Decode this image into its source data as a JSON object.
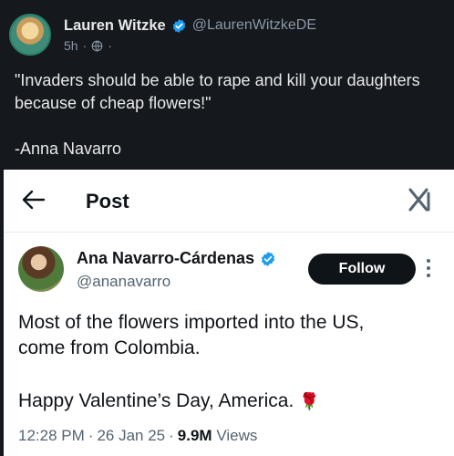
{
  "outer_post": {
    "author_name": "Lauren Witzke",
    "handle": "@LaurenWitzkeDE",
    "timestamp": "5h",
    "meta_dot": "·",
    "text": "\"Invaders should be able to rape and kill your daughters because of cheap flowers!\"",
    "attribution": "-Anna Navarro",
    "icons": {
      "verified": "verified-badge-icon",
      "audience": "globe-icon"
    },
    "colors": {
      "background": "#15181c",
      "verified": "#1d9bf0"
    }
  },
  "embedded_screenshot": {
    "header": {
      "title": "Post",
      "back_icon": "back-arrow-icon",
      "logo_icon": "x-logo-icon"
    },
    "author": {
      "name": "Ana Navarro-Cárdenas",
      "handle": "@ananavarro",
      "follow_label": "Follow",
      "more_icon": "more-vertical-icon"
    },
    "body_line_1": "Most of the flowers imported into the US,",
    "body_line_2": "come from Colombia.",
    "body_line_3": "Happy Valentine’s Day, America.",
    "emoji": "🌹",
    "meta": {
      "time": "12:28 PM",
      "date": "26 Jan 25",
      "views_count": "9.9M",
      "views_label": "Views",
      "sep": "·"
    }
  }
}
